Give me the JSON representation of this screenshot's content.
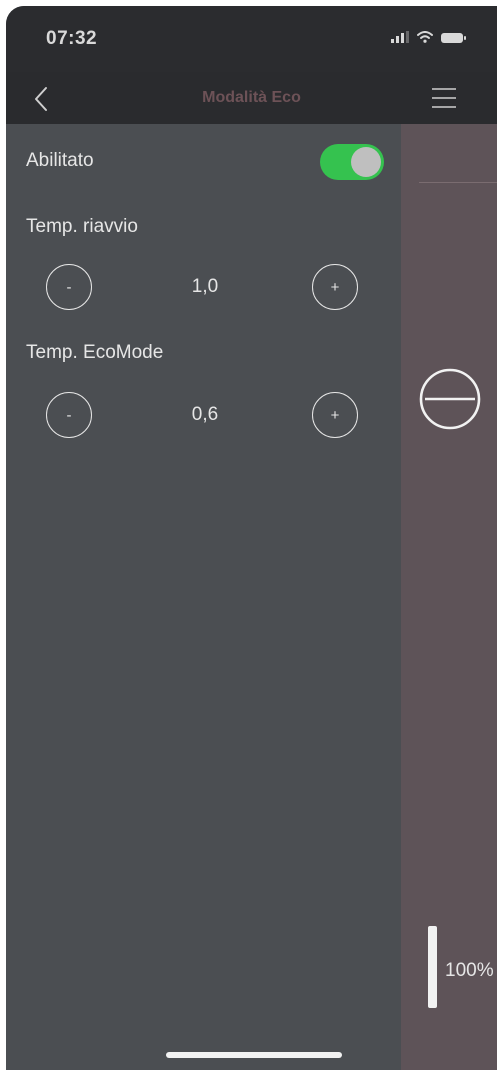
{
  "status_bar": {
    "time": "07:32"
  },
  "nav": {
    "title": "Modalità Eco"
  },
  "settings": {
    "enabled_label": "Abilitato",
    "enabled": true,
    "restart_temp": {
      "label": "Temp. riavvio",
      "value": "1,0",
      "decrement_label": "-",
      "increment_label": "+"
    },
    "ecomode_temp": {
      "label": "Temp. EcoMode",
      "value": "0,6",
      "decrement_label": "-",
      "increment_label": "+"
    }
  },
  "preview": {
    "level_text": "100%",
    "level": 1.0
  },
  "colors": {
    "toggle_on": "#35c24f",
    "panel_bg": "#4b4e52",
    "preview_bg": "#5e5358",
    "title_color": "#6d5257"
  },
  "icons": {
    "back": "chevron-left-icon",
    "menu": "hamburger-menu-icon",
    "minus": "minus-circle-icon",
    "signal": "signal-icon",
    "wifi": "wifi-icon",
    "battery": "battery-icon"
  }
}
